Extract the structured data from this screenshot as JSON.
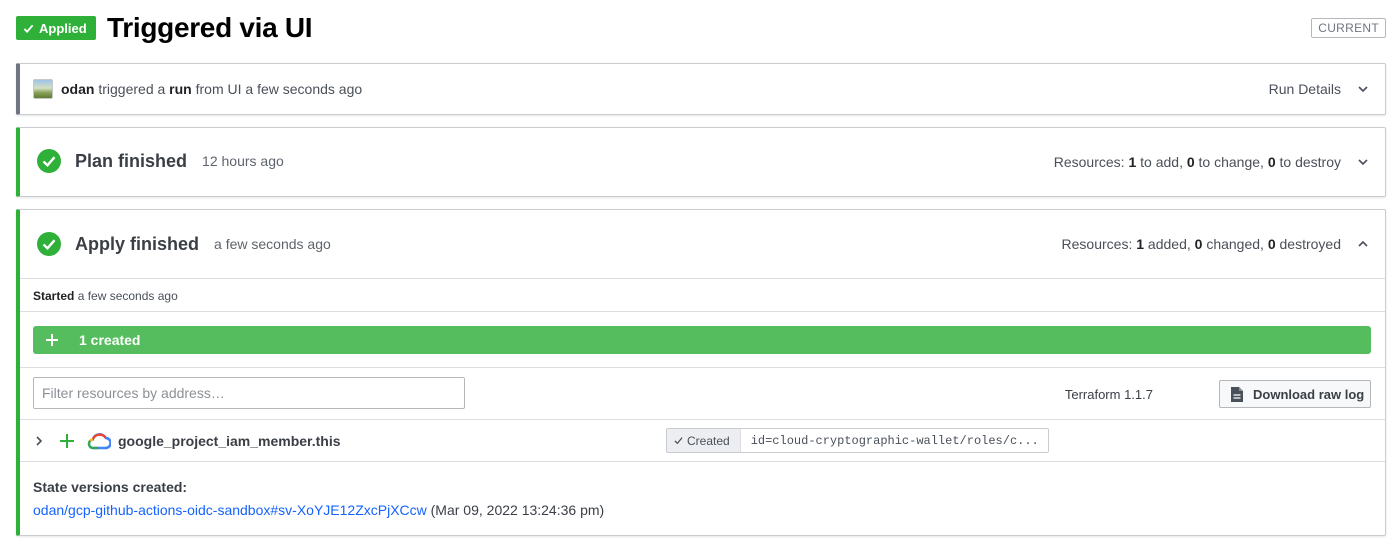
{
  "header": {
    "status_badge": "Applied",
    "title": "Triggered via UI",
    "current_badge": "CURRENT"
  },
  "run": {
    "user": "odan",
    "text_triggered": "triggered a",
    "text_run": "run",
    "text_rest": "from UI a few seconds ago",
    "details_label": "Run Details"
  },
  "plan": {
    "title": "Plan finished",
    "time": "12 hours ago",
    "resources_prefix": "Resources:",
    "add_count": "1",
    "add_label": "to add,",
    "change_count": "0",
    "change_label": "to change,",
    "destroy_count": "0",
    "destroy_label": "to destroy"
  },
  "apply": {
    "title": "Apply finished",
    "time": "a few seconds ago",
    "resources_prefix": "Resources:",
    "added_count": "1",
    "added_label": "added,",
    "changed_count": "0",
    "changed_label": "changed,",
    "destroyed_count": "0",
    "destroyed_label": "destroyed",
    "started_label": "Started",
    "started_time": "a few seconds ago",
    "created_bar_label": "1 created",
    "filter_placeholder": "Filter resources by address…",
    "terraform_version": "Terraform 1.1.7",
    "download_label": "Download raw log",
    "resources": [
      {
        "name": "google_project_iam_member.this",
        "status": "Created",
        "id": "id=cloud-cryptographic-wallet/roles/c..."
      }
    ],
    "state_versions_title": "State versions created:",
    "state_link": "odan/gcp-github-actions-oidc-sandbox#sv-XoYJE12ZxcPjXCcw",
    "state_timestamp": "(Mar 09, 2022 13:24:36 pm)"
  },
  "colors": {
    "success": "#2eb039",
    "created_bar": "#55bd5d",
    "link": "#1563ff",
    "neutral_border": "#6f7682"
  },
  "icons": [
    "check-icon",
    "chevron-down-icon",
    "chevron-up-icon",
    "chevron-right-icon",
    "check-circle-icon",
    "plus-icon",
    "google-cloud-icon",
    "file-icon"
  ]
}
